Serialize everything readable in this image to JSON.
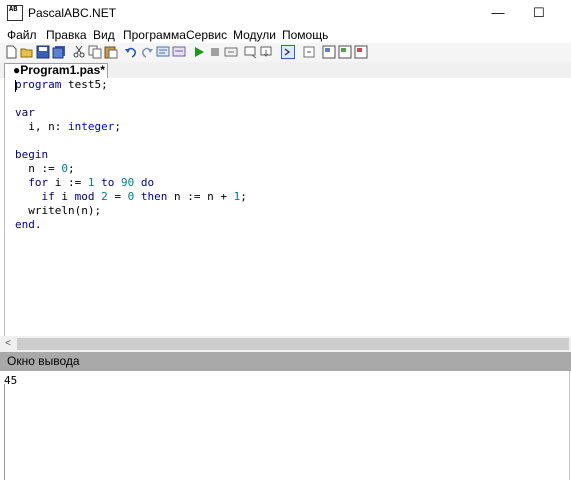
{
  "window": {
    "title": "PascalABC.NET",
    "app_icon_text": "AB\nC#\nNET",
    "minimize": "—",
    "maximize": "☐"
  },
  "menu": {
    "items": [
      "Файл",
      "Правка",
      "Вид",
      "Программа",
      "Сервис",
      "Модули",
      "Помощь"
    ]
  },
  "toolbar": {
    "icons": [
      "new-file",
      "open-file",
      "save-file",
      "save-all",
      "cut",
      "copy",
      "paste",
      "undo",
      "redo",
      "find",
      "replace",
      "run",
      "stop",
      "debug",
      "step-over",
      "step-into",
      "breakpoint",
      "output-window",
      "form-designer",
      "windows-1",
      "windows-2",
      "windows-3"
    ]
  },
  "tab": {
    "label": "●Program1.pas*"
  },
  "editor": {
    "lines": [
      [
        {
          "t": "program",
          "c": "kw"
        },
        {
          "t": " test5;"
        }
      ],
      [],
      [
        {
          "t": "var",
          "c": "kw"
        }
      ],
      [
        {
          "t": "  i, n: "
        },
        {
          "t": "integer",
          "c": "ty"
        },
        {
          "t": ";"
        }
      ],
      [],
      [
        {
          "t": "begin",
          "c": "kw"
        }
      ],
      [
        {
          "t": "  n := "
        },
        {
          "t": "0",
          "c": "nm"
        },
        {
          "t": ";"
        }
      ],
      [
        {
          "t": "  "
        },
        {
          "t": "for",
          "c": "kw"
        },
        {
          "t": " i := "
        },
        {
          "t": "1",
          "c": "nm"
        },
        {
          "t": " "
        },
        {
          "t": "to",
          "c": "kw"
        },
        {
          "t": " "
        },
        {
          "t": "90",
          "c": "nm"
        },
        {
          "t": " "
        },
        {
          "t": "do",
          "c": "kw"
        }
      ],
      [
        {
          "t": "    "
        },
        {
          "t": "if",
          "c": "kw"
        },
        {
          "t": " i "
        },
        {
          "t": "mod",
          "c": "kw"
        },
        {
          "t": " "
        },
        {
          "t": "2",
          "c": "nm"
        },
        {
          "t": " = "
        },
        {
          "t": "0",
          "c": "nm"
        },
        {
          "t": " "
        },
        {
          "t": "then",
          "c": "kw"
        },
        {
          "t": " n := n + "
        },
        {
          "t": "1",
          "c": "nm"
        },
        {
          "t": ";"
        }
      ],
      [
        {
          "t": "  writeln(n);"
        }
      ],
      [
        {
          "t": "end",
          "c": "kw"
        },
        {
          "t": "."
        }
      ]
    ]
  },
  "scrollbar": {
    "left_arrow": "<"
  },
  "output": {
    "header": "Окно вывода",
    "text": "45"
  }
}
